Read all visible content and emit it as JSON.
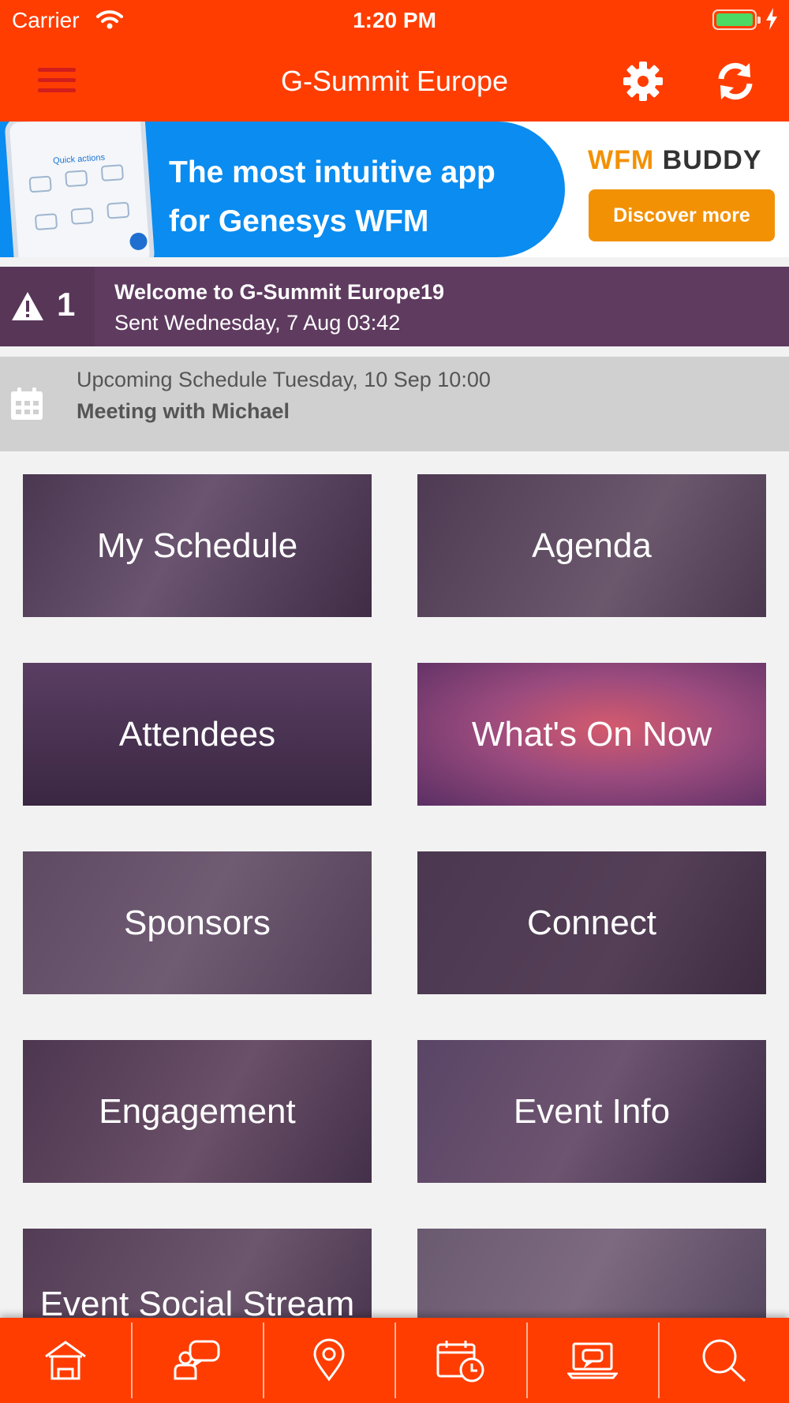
{
  "status_bar": {
    "carrier": "Carrier",
    "time": "1:20 PM"
  },
  "nav": {
    "title": "G-Summit Europe"
  },
  "banner": {
    "headline_line1": "The most intuitive app",
    "headline_line2": "for Genesys WFM",
    "brand_part1": "WFM",
    "brand_part2": "BUDDY",
    "cta": "Discover more",
    "phone_heading": "Quick actions"
  },
  "alert": {
    "count": "1",
    "title": "Welcome to G-Summit Europe19",
    "subtitle": "Sent Wednesday, 7 Aug 03:42"
  },
  "upcoming": {
    "when": "Upcoming Schedule Tuesday, 10 Sep 10:00",
    "what": "Meeting with Michael"
  },
  "tiles": [
    {
      "label": "My Schedule"
    },
    {
      "label": "Agenda"
    },
    {
      "label": "Attendees"
    },
    {
      "label": "What's On Now"
    },
    {
      "label": "Sponsors"
    },
    {
      "label": "Connect"
    },
    {
      "label": "Engagement"
    },
    {
      "label": "Event Info"
    },
    {
      "label": "Event Social Stream"
    },
    {
      "label": ""
    }
  ],
  "tab_bar": {
    "icons": [
      "home-icon",
      "chat-person-icon",
      "location-pin-icon",
      "calendar-clock-icon",
      "laptop-chat-icon",
      "search-icon"
    ]
  },
  "colors": {
    "primary": "#ff3d00",
    "alert_bg": "#5f3b60",
    "upcoming_bg": "#d0d0d0",
    "banner_blue": "#0a8cf0",
    "banner_orange": "#f29104"
  }
}
